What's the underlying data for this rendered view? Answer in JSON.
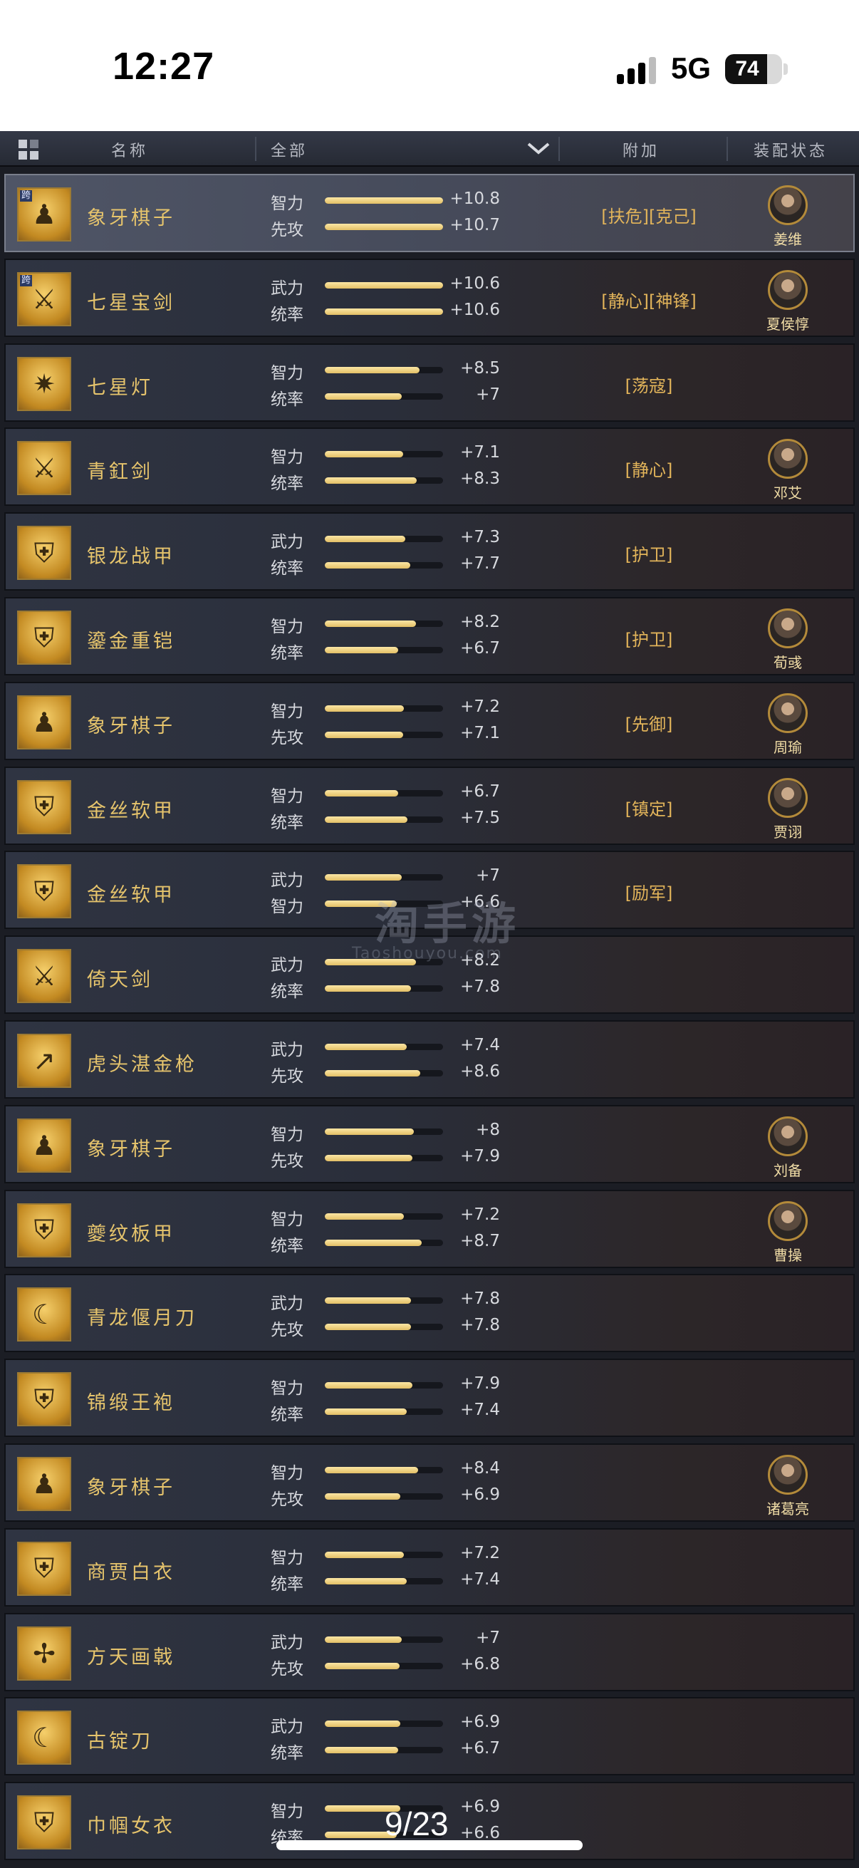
{
  "status_bar": {
    "time": "12:27",
    "network": "5G",
    "battery": "74",
    "battery_level": 0.74
  },
  "header": {
    "col_name": "名称",
    "col_filter": "全部",
    "col_extra": "附加",
    "col_equip": "装配状态"
  },
  "items": [
    {
      "name": "象牙棋子",
      "cross": true,
      "cross_label": "跨",
      "selected": true,
      "glyph": "♟",
      "icon": "chess-pieces-icon",
      "stat1_label": "智力",
      "stat1_value": "+10.8",
      "stat1_level": 1.0,
      "stat2_label": "先攻",
      "stat2_value": "+10.7",
      "stat2_level": 1.0,
      "tags": "[扶危][克己]",
      "hero": "姜维"
    },
    {
      "name": "七星宝剑",
      "cross": true,
      "cross_label": "跨",
      "glyph": "⚔",
      "icon": "sword-icon",
      "stat1_label": "武力",
      "stat1_value": "+10.6",
      "stat1_level": 1.0,
      "stat2_label": "统率",
      "stat2_value": "+10.6",
      "stat2_level": 1.0,
      "tags": "[静心][神锋]",
      "hero": "夏侯惇"
    },
    {
      "name": "七星灯",
      "glyph": "✷",
      "icon": "lamp-icon",
      "stat1_label": "智力",
      "stat1_value": "+8.5",
      "stat1_level": 0.8,
      "stat2_label": "统率",
      "stat2_value": "+7",
      "stat2_level": 0.65,
      "tags": "[荡寇]",
      "hero": ""
    },
    {
      "name": "青釭剑",
      "glyph": "⚔",
      "icon": "sword-icon",
      "stat1_label": "智力",
      "stat1_value": "+7.1",
      "stat1_level": 0.66,
      "stat2_label": "统率",
      "stat2_value": "+8.3",
      "stat2_level": 0.78,
      "tags": "[静心]",
      "hero": "邓艾"
    },
    {
      "name": "银龙战甲",
      "glyph": "⛨",
      "icon": "armor-icon",
      "stat1_label": "武力",
      "stat1_value": "+7.3",
      "stat1_level": 0.68,
      "stat2_label": "统率",
      "stat2_value": "+7.7",
      "stat2_level": 0.72,
      "tags": "[护卫]",
      "hero": ""
    },
    {
      "name": "鎏金重铠",
      "glyph": "⛨",
      "icon": "armor-icon",
      "stat1_label": "智力",
      "stat1_value": "+8.2",
      "stat1_level": 0.77,
      "stat2_label": "统率",
      "stat2_value": "+6.7",
      "stat2_level": 0.62,
      "tags": "[护卫]",
      "hero": "荀彧"
    },
    {
      "name": "象牙棋子",
      "glyph": "♟",
      "icon": "chess-pieces-icon",
      "stat1_label": "智力",
      "stat1_value": "+7.2",
      "stat1_level": 0.67,
      "stat2_label": "先攻",
      "stat2_value": "+7.1",
      "stat2_level": 0.66,
      "tags": "[先御]",
      "hero": "周瑜"
    },
    {
      "name": "金丝软甲",
      "glyph": "⛨",
      "icon": "armor-icon",
      "stat1_label": "智力",
      "stat1_value": "+6.7",
      "stat1_level": 0.62,
      "stat2_label": "统率",
      "stat2_value": "+7.5",
      "stat2_level": 0.7,
      "tags": "[镇定]",
      "hero": "贾诩"
    },
    {
      "name": "金丝软甲",
      "glyph": "⛨",
      "icon": "armor-icon",
      "stat1_label": "武力",
      "stat1_value": "+7",
      "stat1_level": 0.65,
      "stat2_label": "智力",
      "stat2_value": "+6.6",
      "stat2_level": 0.61,
      "tags": "[励军]",
      "hero": ""
    },
    {
      "name": "倚天剑",
      "glyph": "⚔",
      "icon": "sword-icon",
      "stat1_label": "武力",
      "stat1_value": "+8.2",
      "stat1_level": 0.77,
      "stat2_label": "统率",
      "stat2_value": "+7.8",
      "stat2_level": 0.73,
      "tags": "",
      "hero": ""
    },
    {
      "name": "虎头湛金枪",
      "glyph": "↗",
      "icon": "spear-icon",
      "stat1_label": "武力",
      "stat1_value": "+7.4",
      "stat1_level": 0.69,
      "stat2_label": "先攻",
      "stat2_value": "+8.6",
      "stat2_level": 0.81,
      "tags": "",
      "hero": ""
    },
    {
      "name": "象牙棋子",
      "glyph": "♟",
      "icon": "chess-pieces-icon",
      "stat1_label": "智力",
      "stat1_value": "+8",
      "stat1_level": 0.75,
      "stat2_label": "先攻",
      "stat2_value": "+7.9",
      "stat2_level": 0.74,
      "tags": "",
      "hero": "刘备"
    },
    {
      "name": "夔纹板甲",
      "glyph": "⛨",
      "icon": "armor-icon",
      "stat1_label": "智力",
      "stat1_value": "+7.2",
      "stat1_level": 0.67,
      "stat2_label": "统率",
      "stat2_value": "+8.7",
      "stat2_level": 0.82,
      "tags": "",
      "hero": "曹操"
    },
    {
      "name": "青龙偃月刀",
      "glyph": "☾",
      "icon": "glaive-icon",
      "stat1_label": "武力",
      "stat1_value": "+7.8",
      "stat1_level": 0.73,
      "stat2_label": "先攻",
      "stat2_value": "+7.8",
      "stat2_level": 0.73,
      "tags": "",
      "hero": ""
    },
    {
      "name": "锦缎王袍",
      "glyph": "⛨",
      "icon": "robe-icon",
      "stat1_label": "智力",
      "stat1_value": "+7.9",
      "stat1_level": 0.74,
      "stat2_label": "统率",
      "stat2_value": "+7.4",
      "stat2_level": 0.69,
      "tags": "",
      "hero": ""
    },
    {
      "name": "象牙棋子",
      "glyph": "♟",
      "icon": "chess-pieces-icon",
      "stat1_label": "智力",
      "stat1_value": "+8.4",
      "stat1_level": 0.79,
      "stat2_label": "先攻",
      "stat2_value": "+6.9",
      "stat2_level": 0.64,
      "tags": "",
      "hero": "诸葛亮"
    },
    {
      "name": "商贾白衣",
      "glyph": "⛨",
      "icon": "robe-icon",
      "stat1_label": "智力",
      "stat1_value": "+7.2",
      "stat1_level": 0.67,
      "stat2_label": "统率",
      "stat2_value": "+7.4",
      "stat2_level": 0.69,
      "tags": "",
      "hero": ""
    },
    {
      "name": "方天画戟",
      "glyph": "✢",
      "icon": "halberd-icon",
      "stat1_label": "武力",
      "stat1_value": "+7",
      "stat1_level": 0.65,
      "stat2_label": "先攻",
      "stat2_value": "+6.8",
      "stat2_level": 0.63,
      "tags": "",
      "hero": ""
    },
    {
      "name": "古锭刀",
      "glyph": "☾",
      "icon": "blade-icon",
      "stat1_label": "武力",
      "stat1_value": "+6.9",
      "stat1_level": 0.64,
      "stat2_label": "统率",
      "stat2_value": "+6.7",
      "stat2_level": 0.62,
      "tags": "",
      "hero": ""
    },
    {
      "name": "巾帼女衣",
      "glyph": "⛨",
      "icon": "robe-icon",
      "stat1_label": "智力",
      "stat1_value": "+6.9",
      "stat1_level": 0.64,
      "stat2_label": "统率",
      "stat2_value": "+6.6",
      "stat2_level": 0.61,
      "tags": "",
      "hero": ""
    }
  ],
  "watermark": {
    "text": "淘手游",
    "sub": "Taoshouyou.com"
  },
  "page_indicator": "9/23"
}
